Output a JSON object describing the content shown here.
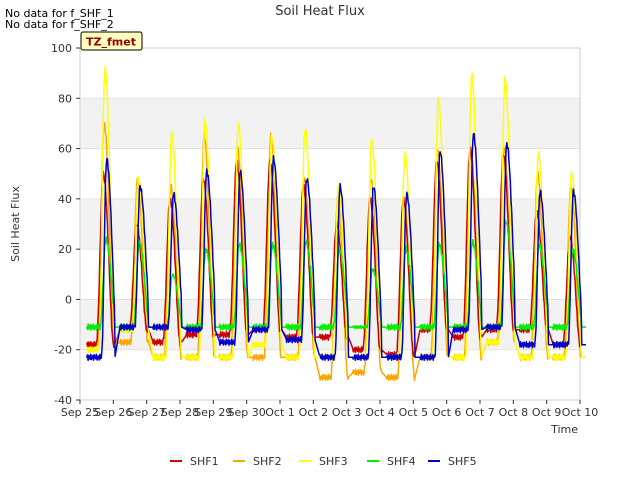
{
  "notes": [
    "No data for f_SHF_1",
    "No data for f_SHF_2"
  ],
  "badge": "TZ_fmet",
  "chart_data": {
    "type": "line",
    "title": "Soil Heat Flux",
    "xlabel": "Time",
    "ylabel": "Soil Heat Flux",
    "ylim": [
      -40,
      100
    ],
    "yticks": [
      -40,
      -20,
      0,
      20,
      40,
      60,
      80,
      100
    ],
    "xlim": [
      0,
      15
    ],
    "xticks": [
      0,
      1,
      2,
      3,
      4,
      5,
      6,
      7,
      8,
      9,
      10,
      11,
      12,
      13,
      14,
      15
    ],
    "xtick_labels": [
      "Sep 25",
      "Sep 26",
      "Sep 27",
      "Sep 28",
      "Sep 29",
      "Sep 30",
      "Oct 1",
      "Oct 2",
      "Oct 3",
      "Oct 4",
      "Oct 5",
      "Oct 6",
      "Oct 7",
      "Oct 8",
      "Oct 9",
      "Oct 10"
    ],
    "grid": "alternating horizontal bands",
    "legend_position": "bottom",
    "days": [
      "Sep 25",
      "Sep 26",
      "Sep 27",
      "Sep 28",
      "Sep 29",
      "Sep 30",
      "Oct 1",
      "Oct 2",
      "Oct 3",
      "Oct 4",
      "Oct 5",
      "Oct 6",
      "Oct 7",
      "Oct 8",
      "Oct 9"
    ],
    "series": [
      {
        "name": "SHF1",
        "color": "#cc0000",
        "daily_min": [
          -18,
          -12,
          -17,
          -14,
          -14,
          -12,
          -15,
          -15,
          -20,
          -22,
          -12,
          -15,
          -12,
          -12,
          -18
        ],
        "daily_max": [
          50,
          30,
          40,
          48,
          55,
          55,
          45,
          30,
          40,
          40,
          55,
          60,
          58,
          35,
          25
        ]
      },
      {
        "name": "SHF2",
        "color": "#ffa500",
        "daily_min": [
          -18,
          -17,
          -23,
          -23,
          -23,
          -23,
          -23,
          -31,
          -29,
          -31,
          -23,
          -23,
          -17,
          -23,
          -23
        ],
        "daily_max": [
          70,
          48,
          45,
          65,
          60,
          65,
          48,
          40,
          48,
          40,
          60,
          60,
          60,
          50,
          45
        ]
      },
      {
        "name": "SHF3",
        "color": "#ffff00",
        "daily_min": [
          -20,
          -12,
          -23,
          -23,
          -23,
          -18,
          -23,
          -23,
          -23,
          -23,
          -23,
          -23,
          -17,
          -23,
          -23
        ],
        "daily_max": [
          92,
          48,
          66,
          71,
          70,
          65,
          68,
          45,
          64,
          58,
          80,
          89,
          88,
          58,
          50
        ]
      },
      {
        "name": "SHF4",
        "color": "#00ee00",
        "daily_min": [
          -11,
          -11,
          -11,
          -11,
          -11,
          -11,
          -11,
          -11,
          -11,
          -11,
          -11,
          -11,
          -11,
          -11,
          -11
        ],
        "daily_max": [
          24,
          23,
          10,
          20,
          22,
          22,
          23,
          20,
          12,
          20,
          22,
          23,
          31,
          22,
          20
        ]
      },
      {
        "name": "SHF5",
        "color": "#0000cc",
        "daily_min": [
          -23,
          -11,
          -11,
          -12,
          -17,
          -12,
          -16,
          -23,
          -23,
          -23,
          -23,
          -12,
          -11,
          -18,
          -18
        ],
        "daily_max": [
          56,
          45,
          42,
          51,
          51,
          56,
          48,
          45,
          45,
          42,
          59,
          66,
          62,
          43,
          43
        ]
      }
    ]
  }
}
